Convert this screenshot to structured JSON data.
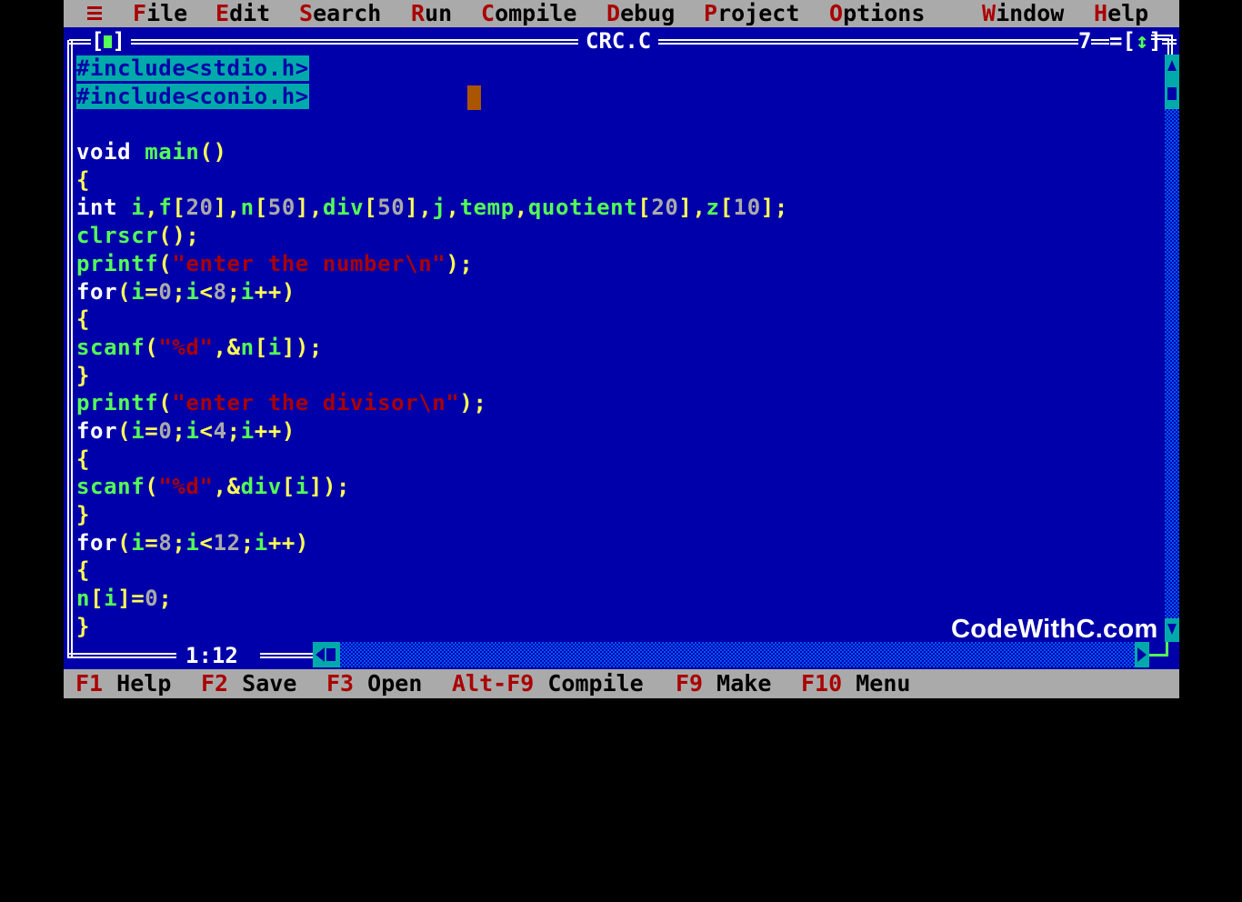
{
  "menubar": {
    "items": [
      {
        "hot": "F",
        "rest": "ile"
      },
      {
        "hot": "E",
        "rest": "dit"
      },
      {
        "hot": "S",
        "rest": "earch"
      },
      {
        "hot": "R",
        "rest": "un"
      },
      {
        "hot": "C",
        "rest": "ompile"
      },
      {
        "hot": "D",
        "rest": "ebug"
      },
      {
        "hot": "P",
        "rest": "roject"
      },
      {
        "hot": "O",
        "rest": "ptions"
      },
      {
        "hot": "W",
        "rest": "indow"
      },
      {
        "hot": "H",
        "rest": "elp"
      }
    ],
    "system_icon": "hamburger-system-menu-icon"
  },
  "window": {
    "title": "CRC.C",
    "close_box_left": "[",
    "close_box_right": "]",
    "window_number": "7",
    "zoom_box_left": "=[",
    "zoom_box_glyph": "↕",
    "zoom_box_right": "]",
    "cursor_position": "1:12"
  },
  "editor": {
    "lines": [
      [
        {
          "t": "sel",
          "v": "#include<stdio.h>"
        }
      ],
      [
        {
          "t": "sel",
          "v": "#include<conio.h>"
        }
      ],
      [],
      [
        {
          "t": "kw",
          "v": "void "
        },
        {
          "t": "id",
          "v": "main"
        },
        {
          "t": "sym",
          "v": "()"
        }
      ],
      [
        {
          "t": "sym",
          "v": "{"
        }
      ],
      [
        {
          "t": "kw",
          "v": "int "
        },
        {
          "t": "id",
          "v": "i"
        },
        {
          "t": "sym",
          "v": ","
        },
        {
          "t": "id",
          "v": "f"
        },
        {
          "t": "sym",
          "v": "["
        },
        {
          "t": "num",
          "v": "20"
        },
        {
          "t": "sym",
          "v": "],"
        },
        {
          "t": "id",
          "v": "n"
        },
        {
          "t": "sym",
          "v": "["
        },
        {
          "t": "num",
          "v": "50"
        },
        {
          "t": "sym",
          "v": "],"
        },
        {
          "t": "id",
          "v": "div"
        },
        {
          "t": "sym",
          "v": "["
        },
        {
          "t": "num",
          "v": "50"
        },
        {
          "t": "sym",
          "v": "],"
        },
        {
          "t": "id",
          "v": "j"
        },
        {
          "t": "sym",
          "v": ","
        },
        {
          "t": "id",
          "v": "temp"
        },
        {
          "t": "sym",
          "v": ","
        },
        {
          "t": "id",
          "v": "quotient"
        },
        {
          "t": "sym",
          "v": "["
        },
        {
          "t": "num",
          "v": "20"
        },
        {
          "t": "sym",
          "v": "],"
        },
        {
          "t": "id",
          "v": "z"
        },
        {
          "t": "sym",
          "v": "["
        },
        {
          "t": "num",
          "v": "10"
        },
        {
          "t": "sym",
          "v": "];"
        }
      ],
      [
        {
          "t": "id",
          "v": "clrscr"
        },
        {
          "t": "sym",
          "v": "();"
        }
      ],
      [
        {
          "t": "id",
          "v": "printf"
        },
        {
          "t": "sym",
          "v": "("
        },
        {
          "t": "str",
          "v": "\"enter the number\\n\""
        },
        {
          "t": "sym",
          "v": ");"
        }
      ],
      [
        {
          "t": "kw",
          "v": "for"
        },
        {
          "t": "sym",
          "v": "("
        },
        {
          "t": "id",
          "v": "i"
        },
        {
          "t": "sym",
          "v": "="
        },
        {
          "t": "num",
          "v": "0"
        },
        {
          "t": "sym",
          "v": ";"
        },
        {
          "t": "id",
          "v": "i"
        },
        {
          "t": "sym",
          "v": "<"
        },
        {
          "t": "num",
          "v": "8"
        },
        {
          "t": "sym",
          "v": ";"
        },
        {
          "t": "id",
          "v": "i"
        },
        {
          "t": "sym",
          "v": "++)"
        }
      ],
      [
        {
          "t": "sym",
          "v": "{"
        }
      ],
      [
        {
          "t": "id",
          "v": "scanf"
        },
        {
          "t": "sym",
          "v": "("
        },
        {
          "t": "str",
          "v": "\"%d\""
        },
        {
          "t": "sym",
          "v": ",&"
        },
        {
          "t": "id",
          "v": "n"
        },
        {
          "t": "sym",
          "v": "["
        },
        {
          "t": "id",
          "v": "i"
        },
        {
          "t": "sym",
          "v": "]);"
        }
      ],
      [
        {
          "t": "sym",
          "v": "}"
        }
      ],
      [
        {
          "t": "id",
          "v": "printf"
        },
        {
          "t": "sym",
          "v": "("
        },
        {
          "t": "str",
          "v": "\"enter the divisor\\n\""
        },
        {
          "t": "sym",
          "v": ");"
        }
      ],
      [
        {
          "t": "kw",
          "v": "for"
        },
        {
          "t": "sym",
          "v": "("
        },
        {
          "t": "id",
          "v": "i"
        },
        {
          "t": "sym",
          "v": "="
        },
        {
          "t": "num",
          "v": "0"
        },
        {
          "t": "sym",
          "v": ";"
        },
        {
          "t": "id",
          "v": "i"
        },
        {
          "t": "sym",
          "v": "<"
        },
        {
          "t": "num",
          "v": "4"
        },
        {
          "t": "sym",
          "v": ";"
        },
        {
          "t": "id",
          "v": "i"
        },
        {
          "t": "sym",
          "v": "++)"
        }
      ],
      [
        {
          "t": "sym",
          "v": "{"
        }
      ],
      [
        {
          "t": "id",
          "v": "scanf"
        },
        {
          "t": "sym",
          "v": "("
        },
        {
          "t": "str",
          "v": "\"%d\""
        },
        {
          "t": "sym",
          "v": ",&"
        },
        {
          "t": "id",
          "v": "div"
        },
        {
          "t": "sym",
          "v": "["
        },
        {
          "t": "id",
          "v": "i"
        },
        {
          "t": "sym",
          "v": "]);"
        }
      ],
      [
        {
          "t": "sym",
          "v": "}"
        }
      ],
      [
        {
          "t": "kw",
          "v": "for"
        },
        {
          "t": "sym",
          "v": "("
        },
        {
          "t": "id",
          "v": "i"
        },
        {
          "t": "sym",
          "v": "="
        },
        {
          "t": "num",
          "v": "8"
        },
        {
          "t": "sym",
          "v": ";"
        },
        {
          "t": "id",
          "v": "i"
        },
        {
          "t": "sym",
          "v": "<"
        },
        {
          "t": "num",
          "v": "12"
        },
        {
          "t": "sym",
          "v": ";"
        },
        {
          "t": "id",
          "v": "i"
        },
        {
          "t": "sym",
          "v": "++)"
        }
      ],
      [
        {
          "t": "sym",
          "v": "{"
        }
      ],
      [
        {
          "t": "id",
          "v": "n"
        },
        {
          "t": "sym",
          "v": "["
        },
        {
          "t": "id",
          "v": "i"
        },
        {
          "t": "sym",
          "v": "]="
        },
        {
          "t": "num",
          "v": "0"
        },
        {
          "t": "sym",
          "v": ";"
        }
      ],
      [
        {
          "t": "sym",
          "v": "}"
        }
      ]
    ]
  },
  "statusbar": {
    "items": [
      {
        "key": "F1",
        "label": "Help"
      },
      {
        "key": "F2",
        "label": "Save"
      },
      {
        "key": "F3",
        "label": "Open"
      },
      {
        "key": "Alt-F9",
        "label": "Compile"
      },
      {
        "key": "F9",
        "label": "Make"
      },
      {
        "key": "F10",
        "label": "Menu"
      }
    ]
  },
  "watermark": "CodeWithC.com",
  "colors": {
    "editor_bg": "#0000aa",
    "menu_bg": "#aaaaaa",
    "hotkey": "#aa0000",
    "keyword": "#ffffff",
    "identifier": "#55ff55",
    "symbol": "#ffff55",
    "number": "#aaaaaa",
    "string": "#aa0000",
    "selection_bg": "#00aaaa",
    "cursor": "#aa5500"
  }
}
